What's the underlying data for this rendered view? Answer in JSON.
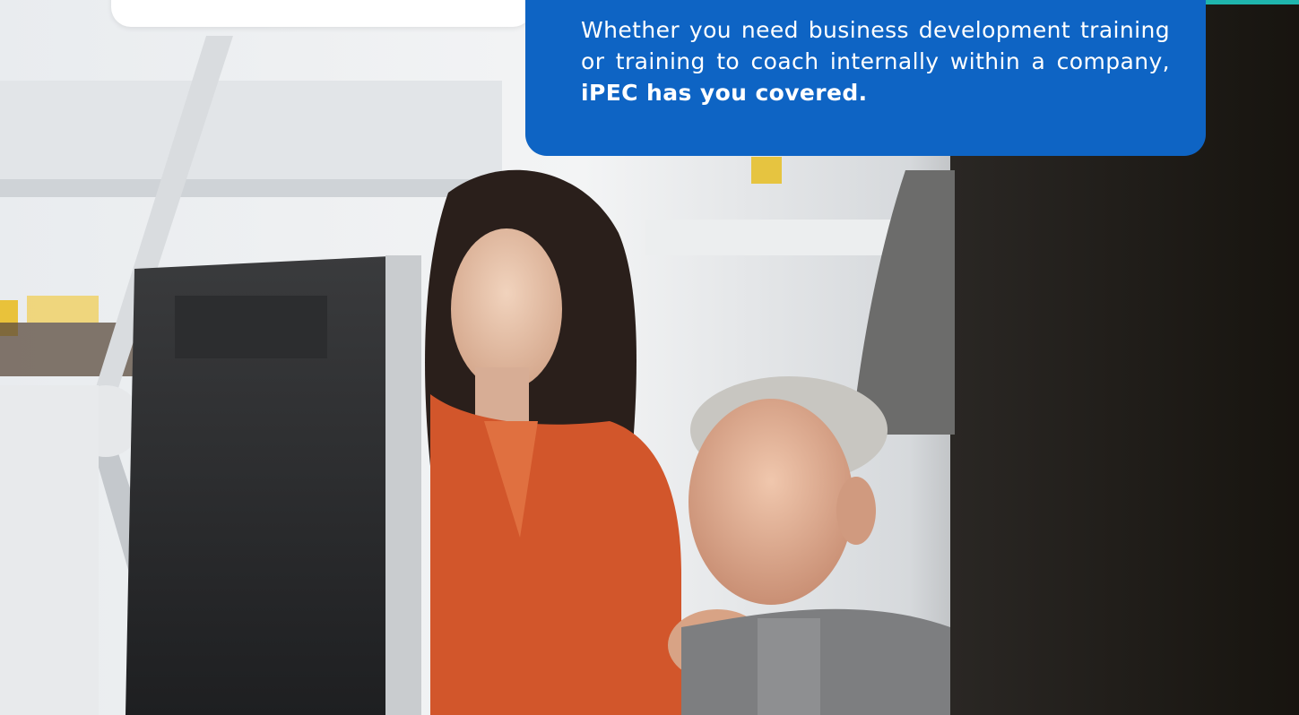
{
  "callout": {
    "text_lead": "Whether you need business development training or training to coach internally within a company, ",
    "text_emphasis": "iPEC has you covered."
  },
  "hero_image": {
    "description_icon": "office-photo-icon"
  },
  "colors": {
    "callout_background": "#0e64c4",
    "callout_text": "#ffffff",
    "accent": "#1fb5ad",
    "card": "#ffffff"
  }
}
